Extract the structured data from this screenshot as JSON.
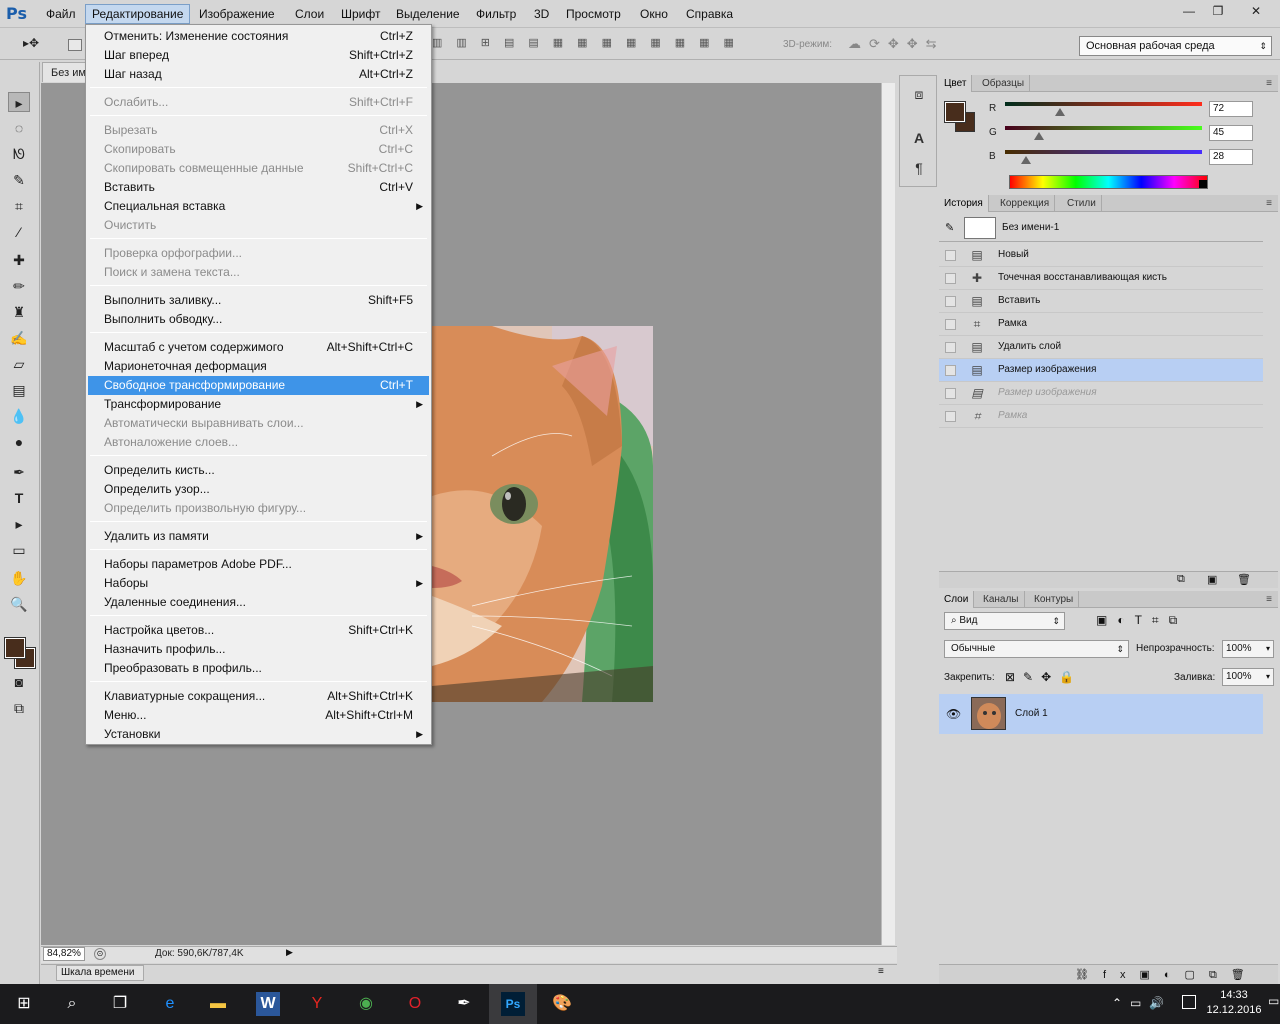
{
  "app": {
    "logo": "Ps"
  },
  "menubar": {
    "items": [
      "Файл",
      "Редактирование",
      "Изображение",
      "Слои",
      "Шрифт",
      "Выделение",
      "Фильтр",
      "3D",
      "Просмотр",
      "Окно",
      "Справка"
    ],
    "active_index": 1
  },
  "window_controls": {
    "minimize": "—",
    "restore": "❐",
    "close": "✕"
  },
  "options_bar": {
    "mode_3d_label": "3D-режим:",
    "workspace_value": "Основная рабочая среда"
  },
  "document": {
    "tab_title": "Без имени-1",
    "zoom": "84,82%",
    "doc_info": "Док: 590,6K/787,4K",
    "timeline_tab": "Шкала времени"
  },
  "edit_menu": [
    {
      "label": "Отменить: Изменение состояния",
      "shortcut": "Ctrl+Z",
      "disabled": false
    },
    {
      "label": "Шаг вперед",
      "shortcut": "Shift+Ctrl+Z",
      "disabled": false
    },
    {
      "label": "Шаг назад",
      "shortcut": "Alt+Ctrl+Z",
      "disabled": false
    },
    {
      "sep": true
    },
    {
      "label": "Ослабить...",
      "shortcut": "Shift+Ctrl+F",
      "disabled": true
    },
    {
      "sep": true
    },
    {
      "label": "Вырезать",
      "shortcut": "Ctrl+X",
      "disabled": true
    },
    {
      "label": "Скопировать",
      "shortcut": "Ctrl+C",
      "disabled": true
    },
    {
      "label": "Скопировать совмещенные данные",
      "shortcut": "Shift+Ctrl+C",
      "disabled": true
    },
    {
      "label": "Вставить",
      "shortcut": "Ctrl+V",
      "disabled": false
    },
    {
      "label": "Специальная вставка",
      "submenu": true,
      "disabled": false
    },
    {
      "label": "Очистить",
      "disabled": true
    },
    {
      "sep": true
    },
    {
      "label": "Проверка орфографии...",
      "disabled": true
    },
    {
      "label": "Поиск и замена текста...",
      "disabled": true
    },
    {
      "sep": true
    },
    {
      "label": "Выполнить заливку...",
      "shortcut": "Shift+F5",
      "disabled": false
    },
    {
      "label": "Выполнить обводку...",
      "disabled": false
    },
    {
      "sep": true
    },
    {
      "label": "Масштаб с учетом содержимого",
      "shortcut": "Alt+Shift+Ctrl+C",
      "disabled": false
    },
    {
      "label": "Марионеточная деформация",
      "disabled": false
    },
    {
      "label": "Свободное трансформирование",
      "shortcut": "Ctrl+T",
      "disabled": false,
      "highlighted": true
    },
    {
      "label": "Трансформирование",
      "submenu": true,
      "disabled": false
    },
    {
      "label": "Автоматически выравнивать слои...",
      "disabled": true
    },
    {
      "label": "Автоналожение слоев...",
      "disabled": true
    },
    {
      "sep": true
    },
    {
      "label": "Определить кисть...",
      "disabled": false
    },
    {
      "label": "Определить узор...",
      "disabled": false
    },
    {
      "label": "Определить произвольную фигуру...",
      "disabled": true
    },
    {
      "sep": true
    },
    {
      "label": "Удалить из памяти",
      "submenu": true,
      "disabled": false
    },
    {
      "sep": true
    },
    {
      "label": "Наборы параметров Adobe PDF...",
      "disabled": false
    },
    {
      "label": "Наборы",
      "submenu": true,
      "disabled": false
    },
    {
      "label": "Удаленные соединения...",
      "disabled": false
    },
    {
      "sep": true
    },
    {
      "label": "Настройка цветов...",
      "shortcut": "Shift+Ctrl+K",
      "disabled": false
    },
    {
      "label": "Назначить профиль...",
      "disabled": false
    },
    {
      "label": "Преобразовать в профиль...",
      "disabled": false
    },
    {
      "sep": true
    },
    {
      "label": "Клавиатурные сокращения...",
      "shortcut": "Alt+Shift+Ctrl+K",
      "disabled": false
    },
    {
      "label": "Меню...",
      "shortcut": "Alt+Shift+Ctrl+M",
      "disabled": false
    },
    {
      "label": "Установки",
      "submenu": true,
      "disabled": false
    }
  ],
  "color_panel": {
    "tabs": [
      "Цвет",
      "Образцы"
    ],
    "r_label": "R",
    "g_label": "G",
    "b_label": "B",
    "r": "72",
    "g": "45",
    "b": "28",
    "fg_color": "#482d1c"
  },
  "history_panel": {
    "tabs": [
      "История",
      "Коррекция",
      "Стили"
    ],
    "snapshot": "Без имени-1",
    "states": [
      {
        "label": "Новый",
        "icon": "doc-icon",
        "state": "normal"
      },
      {
        "label": "Точечная восстанавливающая кисть",
        "icon": "healing-brush-icon",
        "state": "normal"
      },
      {
        "label": "Вставить",
        "icon": "doc-icon",
        "state": "normal"
      },
      {
        "label": "Рамка",
        "icon": "crop-icon",
        "state": "normal"
      },
      {
        "label": "Удалить слой",
        "icon": "doc-icon",
        "state": "normal"
      },
      {
        "label": "Размер изображения",
        "icon": "doc-icon",
        "state": "current"
      },
      {
        "label": "Размер изображения",
        "icon": "doc-icon",
        "state": "undone"
      },
      {
        "label": "Рамка",
        "icon": "crop-icon",
        "state": "undone"
      }
    ]
  },
  "layers_panel": {
    "tabs": [
      "Слои",
      "Каналы",
      "Контуры"
    ],
    "filter_value": "Вид",
    "blend_mode": "Обычные",
    "opacity_label": "Непрозрачность:",
    "opacity": "100%",
    "lock_label": "Закрепить:",
    "fill_label": "Заливка:",
    "fill": "100%",
    "layers": [
      {
        "name": "Слой 1",
        "visible": true,
        "selected": true
      }
    ]
  },
  "taskbar": {
    "time": "14:33",
    "date": "12.12.2016"
  }
}
